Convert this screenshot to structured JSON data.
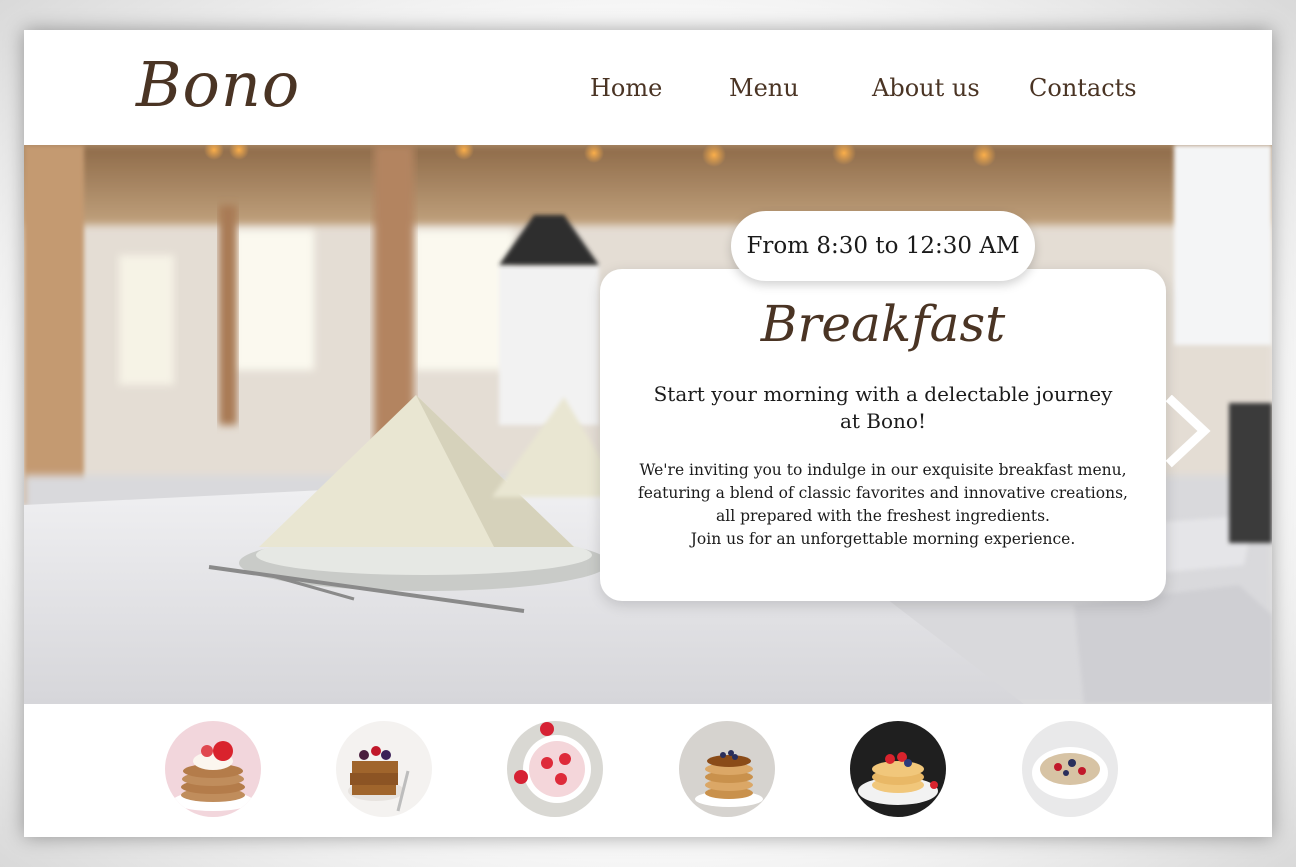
{
  "brand": {
    "logo": "Bono",
    "color": "#4a3424"
  },
  "nav": {
    "home": "Home",
    "menu": "Menu",
    "about": "About us",
    "contacts": "Contacts"
  },
  "hero": {
    "hours": "From 8:30 to 12:30 AM",
    "title": "Breakfast",
    "lead": "Start your morning with a delectable journey at Bono!",
    "body_lines": [
      "We're inviting you to indulge in our exquisite breakfast menu,",
      "featuring a blend of classic favorites and innovative creations,",
      "all prepared with the freshest ingredients.",
      "Join us for an unforgettable morning experience."
    ],
    "next_icon": "chevron-right-icon"
  },
  "thumbnails": [
    {
      "name": "pancakes-strawberry-thumb"
    },
    {
      "name": "waffles-berries-thumb"
    },
    {
      "name": "strawberry-bowl-thumb"
    },
    {
      "name": "pancake-stack-blueberry-thumb"
    },
    {
      "name": "pancakes-fruit-thumb"
    },
    {
      "name": "granola-bowl-thumb"
    }
  ]
}
